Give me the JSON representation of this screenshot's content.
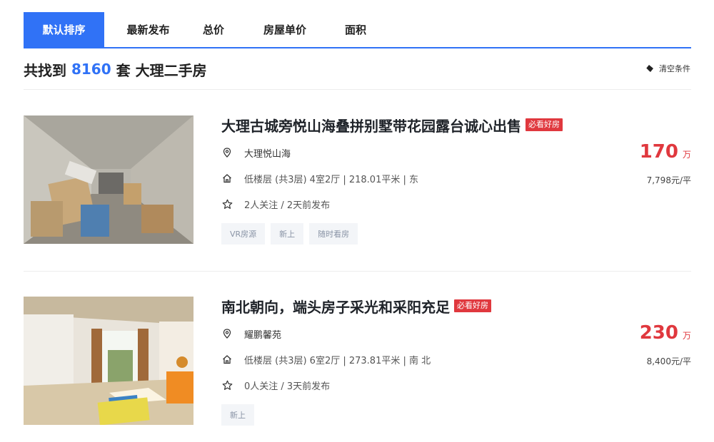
{
  "tabs": [
    {
      "label": "默认排序",
      "active": true
    },
    {
      "label": "最新发布",
      "active": false
    },
    {
      "label": "总价",
      "active": false
    },
    {
      "label": "房屋单价",
      "active": false
    },
    {
      "label": "面积",
      "active": false
    }
  ],
  "summary": {
    "prefix": "共找到 ",
    "count": "8160",
    "suffix": " 套 大理二手房",
    "clear_label": "清空条件",
    "clear_icon": "eraser-icon"
  },
  "colors": {
    "accent": "#3072f6",
    "price": "#e0383e",
    "badge": "#e0383e",
    "tag_bg": "#f3f5f8"
  },
  "listings": [
    {
      "title": "大理古城旁悦山海叠拼别墅带花园露台诚心出售",
      "badge": "必看好房",
      "community": "大理悦山海",
      "house_info": "低楼层 (共3层) 4室2厅 | 218.01平米 | 东",
      "follow_info": "2人关注 / 2天前发布",
      "tags": [
        "VR房源",
        "新上",
        "随时看房"
      ],
      "total_price": "170",
      "total_unit": "万",
      "unit_price": "7,798元/平",
      "image": "unfinished-villa-interior-photo"
    },
    {
      "title": "南北朝向，端头房子采光和采阳充足",
      "badge": "必看好房",
      "community": "耀鹏馨苑",
      "house_info": "低楼层 (共3层) 6室2厅 | 273.81平米 | 南 北",
      "follow_info": "0人关注 / 3天前发布",
      "tags": [
        "新上"
      ],
      "total_price": "230",
      "total_unit": "万",
      "unit_price": "8,400元/平",
      "image": "sunlit-room-interior-photo"
    }
  ]
}
